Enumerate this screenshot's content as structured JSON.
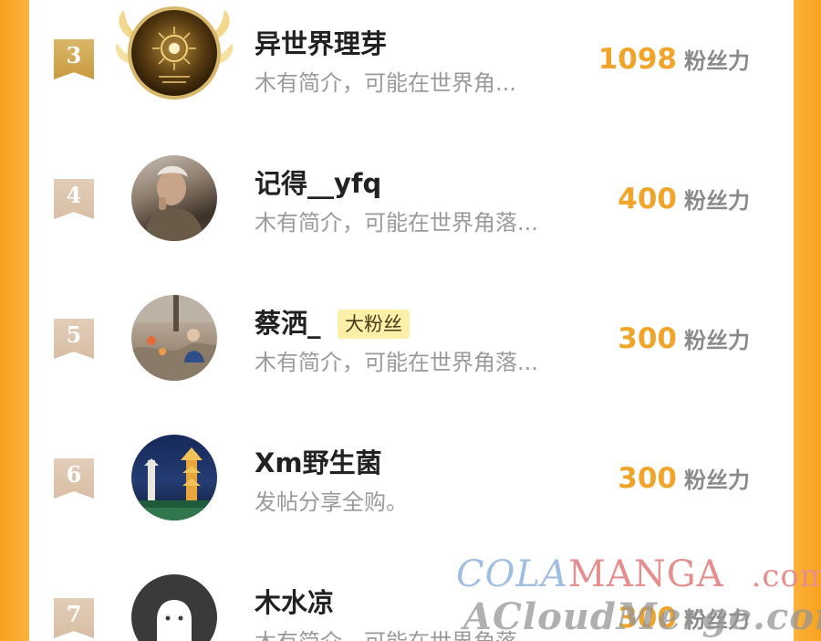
{
  "unit_label": "粉丝力",
  "rows": [
    {
      "rank": "3",
      "name": "异世界理芽",
      "bio": "木有简介，可能在世界角...",
      "score": "1098",
      "badge": ""
    },
    {
      "rank": "4",
      "name": "记得__yfq",
      "bio": "木有简介，可能在世界角落...",
      "score": "400",
      "badge": ""
    },
    {
      "rank": "5",
      "name": "蔡洒_",
      "bio": "木有简介，可能在世界角落...",
      "score": "300",
      "badge": "大粉丝"
    },
    {
      "rank": "6",
      "name": "Xm野生菌",
      "bio": "发帖分享全购。",
      "score": "300",
      "badge": ""
    },
    {
      "rank": "7",
      "name": "木水凉",
      "bio": "木有简介，可能在世界角落",
      "score": "300",
      "badge": ""
    }
  ],
  "watermark": {
    "line1_a": "COLA",
    "line1_b": "MANGA",
    "line1_c": ".com",
    "line2": "ACloudMerge.com"
  },
  "colors": {
    "accent_orange": "#fbb23d",
    "score_color": "#f0a52a",
    "badge_bg": "#fcefa8"
  }
}
